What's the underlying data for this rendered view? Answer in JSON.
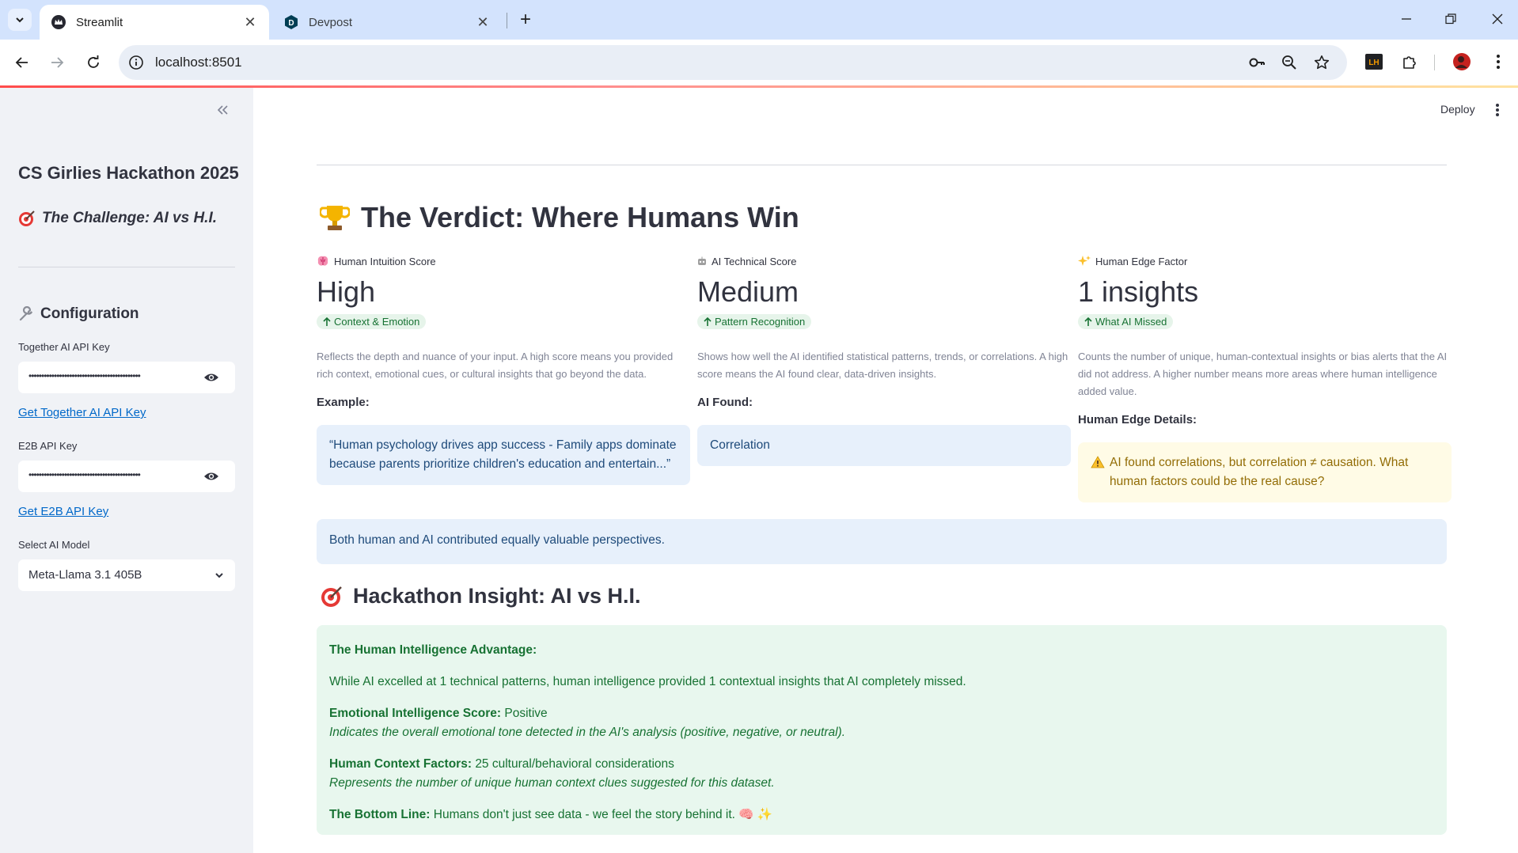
{
  "browser": {
    "tabs": [
      {
        "title": "Streamlit",
        "active": true
      },
      {
        "title": "Devpost",
        "active": false
      }
    ],
    "url": "localhost:8501"
  },
  "sidebar": {
    "title": "CS Girlies Hackathon 2025",
    "challenge": "The Challenge: AI vs H.I.",
    "configuration": "Configuration",
    "together_label": "Together AI API Key",
    "together_value": "••••••••••••••••••••••••••••••••••••••••••••",
    "together_link": "Get Together AI API Key",
    "e2b_label": "E2B API Key",
    "e2b_value": "••••••••••••••••••••••••••••••••••••••••••••",
    "e2b_link": "Get E2B API Key",
    "model_label": "Select AI Model",
    "model_value": "Meta-Llama 3.1 405B"
  },
  "header": {
    "deploy": "Deploy"
  },
  "main": {
    "verdict_title": "The Verdict: Where Humans Win",
    "metrics": [
      {
        "label": "Human Intuition Score",
        "value": "High",
        "delta": "Context & Emotion",
        "description": "Reflects the depth and nuance of your input. A high score means you provided rich context, emotional cues, or cultural insights that go beyond the data.",
        "sub_label": "Example:",
        "box": "“Human psychology drives app success - Family apps dominate because parents prioritize children's education and entertain...”"
      },
      {
        "label": "AI Technical Score",
        "value": "Medium",
        "delta": "Pattern Recognition",
        "description": "Shows how well the AI identified statistical patterns, trends, or correlations. A high score means the AI found clear, data-driven insights.",
        "sub_label": "AI Found:",
        "box": "Correlation"
      },
      {
        "label": "Human Edge Factor",
        "value": "1 insights",
        "delta": "What AI Missed",
        "description": "Counts the number of unique, human-contextual insights or bias alerts that the AI did not address. A higher number means more areas where human intelligence added value.",
        "sub_label": "Human Edge Details:",
        "box": "AI found correlations, but correlation ≠ causation. What human factors could be the real cause?"
      }
    ],
    "balance_message": "Both human and AI contributed equally valuable perspectives.",
    "insight_title": "Hackathon Insight: AI vs H.I.",
    "insight": {
      "advantage_title": "The Human Intelligence Advantage:",
      "advantage_text": "While AI excelled at 1 technical patterns, human intelligence provided 1 contextual insights that AI completely missed.",
      "emotional_label": "Emotional Intelligence Score:",
      "emotional_value": "Positive",
      "emotional_note": "Indicates the overall emotional tone detected in the AI's analysis (positive, negative, or neutral).",
      "context_label": "Human Context Factors:",
      "context_value": "25 cultural/behavioral considerations",
      "context_note": "Represents the number of unique human context clues suggested for this dataset.",
      "bottom_label": "The Bottom Line:",
      "bottom_value": "Humans don't just see data - we feel the story behind it. 🧠 ✨"
    }
  }
}
